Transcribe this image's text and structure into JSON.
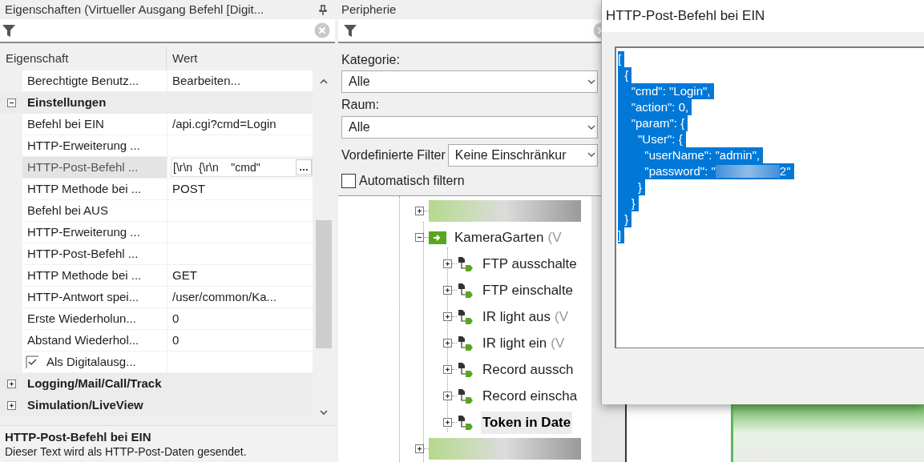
{
  "properties_panel": {
    "title": "Eigenschaften (Virtueller Ausgang Befehl [Digit...",
    "columns": [
      "Eigenschaft",
      "Wert"
    ],
    "rows": [
      {
        "kind": "row",
        "label": "Berechtigte Benutz...",
        "value": "Bearbeiten...",
        "selected": false
      },
      {
        "kind": "group",
        "label": "Einstellungen",
        "expanded": true
      },
      {
        "kind": "row",
        "label": "Befehl bei EIN",
        "value": "/api.cgi?cmd=Login",
        "selected": false
      },
      {
        "kind": "row",
        "label": "HTTP-Erweiterung ...",
        "selected": false
      },
      {
        "kind": "row",
        "label": "HTTP-Post-Befehl ...",
        "value": "[\\r\\n  {\\r\\n    \"cmd\"",
        "button": "…",
        "selected": true
      },
      {
        "kind": "row",
        "label": "HTTP Methode bei ...",
        "value": "POST",
        "selected": false
      },
      {
        "kind": "row",
        "label": "Befehl bei AUS",
        "selected": false
      },
      {
        "kind": "row",
        "label": "HTTP-Erweiterung ...",
        "selected": false
      },
      {
        "kind": "row",
        "label": "HTTP-Post-Befehl ...",
        "selected": false
      },
      {
        "kind": "row",
        "label": "HTTP Methode bei ...",
        "value": "GET",
        "selected": false
      },
      {
        "kind": "row",
        "label": "HTTP-Antwort spei...",
        "value": "/user/common/Ka...",
        "selected": false
      },
      {
        "kind": "row",
        "label": "Erste Wiederholun...",
        "value": "0",
        "selected": false
      },
      {
        "kind": "row",
        "label": "Abstand Wiederhol...",
        "value": "0",
        "selected": false
      },
      {
        "kind": "check",
        "label": "Als Digitalausg...",
        "checked": true
      },
      {
        "kind": "group",
        "label": "Logging/Mail/Call/Track",
        "expanded": false
      },
      {
        "kind": "group",
        "label": "Simulation/LiveView",
        "expanded": false
      }
    ],
    "description": {
      "title": "HTTP-Post-Befehl bei EIN",
      "text": "Dieser Text wird als HTTP-Post-Daten gesendet."
    }
  },
  "peripherals_panel": {
    "title": "Peripherie",
    "category_label": "Kategorie:",
    "category": "Alle",
    "room_label": "Raum:",
    "room": "Alle",
    "filter_label": "Vordefinierte Filter",
    "filter": "Keine Einschränkur",
    "auto_filter": {
      "label": "Automatisch filtern",
      "checked": false
    },
    "tree": [
      {
        "kind": "redacted",
        "expanded": false
      },
      {
        "kind": "node",
        "name": "KameraGarten",
        "suffix": "(V",
        "expanded": true,
        "selected": false,
        "children": [
          {
            "kind": "node",
            "name": "FTP ausschalte",
            "expanded": false,
            "selected": false
          },
          {
            "kind": "node",
            "name": "FTP einschalte",
            "expanded": false,
            "selected": false
          },
          {
            "kind": "node",
            "name": "IR light aus",
            "suffix": "(V",
            "expanded": false,
            "selected": false
          },
          {
            "kind": "node",
            "name": "IR light ein",
            "suffix": "(V",
            "expanded": false,
            "selected": false
          },
          {
            "kind": "node",
            "name": "Record aussch",
            "expanded": false,
            "selected": false
          },
          {
            "kind": "node",
            "name": "Record einscha",
            "expanded": false,
            "selected": false
          },
          {
            "kind": "node",
            "name": "Token in Date",
            "expanded": false,
            "selected": true
          }
        ]
      },
      {
        "kind": "redacted",
        "expanded": false
      }
    ]
  },
  "dialog": {
    "title": "HTTP-Post-Befehl bei EIN",
    "text_selected": true,
    "lines": [
      {
        "kind": "text",
        "text": "["
      },
      {
        "kind": "text",
        "text": "  {"
      },
      {
        "kind": "text",
        "text": "    \"cmd\": \"Login\","
      },
      {
        "kind": "text",
        "text": "    \"action\": 0,"
      },
      {
        "kind": "text",
        "text": "    \"param\": {"
      },
      {
        "kind": "text",
        "text": "      \"User\": {"
      },
      {
        "kind": "text",
        "text": "        \"userName\": \"admin\","
      },
      {
        "kind": "redacted",
        "before": "        \"password\": \"",
        "after": "2\""
      },
      {
        "kind": "text",
        "text": "      }"
      },
      {
        "kind": "text",
        "text": "    }"
      },
      {
        "kind": "text",
        "text": "  }"
      },
      {
        "kind": "text",
        "text": "]"
      }
    ]
  }
}
